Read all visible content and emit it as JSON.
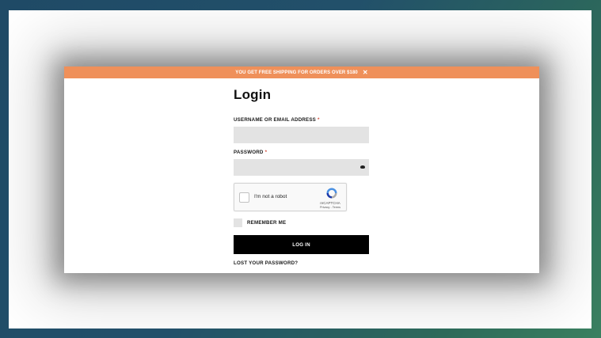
{
  "promo": {
    "text": "YOU GET FREE SHIPPING FOR ORDERS OVER $180",
    "close_icon": "close-icon",
    "background": "#ef905a"
  },
  "login": {
    "title": "Login",
    "username_label": "USERNAME OR EMAIL ADDRESS",
    "password_label": "PASSWORD",
    "required_marker": "*",
    "username_value": "",
    "password_value": "",
    "captcha": {
      "label": "I'm not a robot",
      "brand": "reCAPTCHA",
      "links": "Privacy - Terms"
    },
    "remember_label": "REMEMBER ME",
    "submit_label": "LOG IN",
    "lost_password_label": "LOST YOUR PASSWORD?"
  }
}
